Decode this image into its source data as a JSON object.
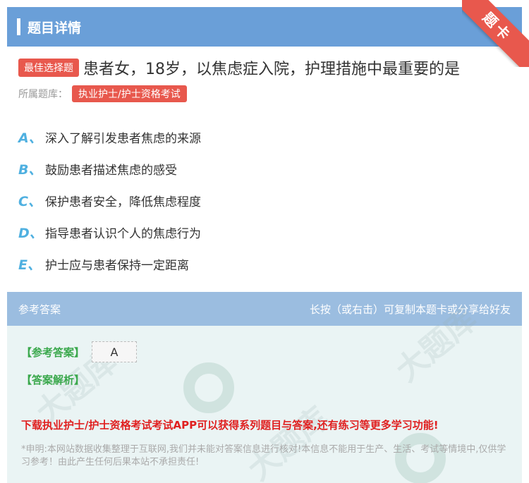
{
  "header": {
    "title": "题目详情",
    "ribbon": "题卡"
  },
  "question": {
    "tag": "最佳选择题",
    "text": "患者女，18岁，以焦虑症入院，护理措施中最重要的是",
    "bank_label": "所属题库：",
    "bank_name": "执业护士/护士资格考试"
  },
  "options": [
    {
      "letter": "A、",
      "text": "深入了解引发患者焦虑的来源"
    },
    {
      "letter": "B、",
      "text": "鼓励患者描述焦虑的感受"
    },
    {
      "letter": "C、",
      "text": "保护患者安全，降低焦虑程度"
    },
    {
      "letter": "D、",
      "text": "指导患者认识个人的焦虑行为"
    },
    {
      "letter": "E、",
      "text": "护士应与患者保持一定距离"
    }
  ],
  "answer": {
    "title": "参考答案",
    "hint": "长按（或右击）可复制本题卡或分享给好友",
    "key_label": "【参考答案】",
    "key_value": "A",
    "analysis_label": "【答案解析】",
    "promo": "下载执业护士/护士资格考试考试APP可以获得系列题目与答案,还有练习等更多学习功能!",
    "disclaimer": "*申明:本网站数据收集整理于互联网,我们并未能对答案信息进行核对!本信息不能用于生产、生活、考试等情境中,仅供学习参考！由此产生任何后果本站不承担责任!"
  },
  "colors": {
    "header": "#6a9fd8",
    "accent_red": "#e8584d",
    "option_letter": "#4fb0e0",
    "green": "#3aa84c",
    "promo_red": "#e02020"
  }
}
